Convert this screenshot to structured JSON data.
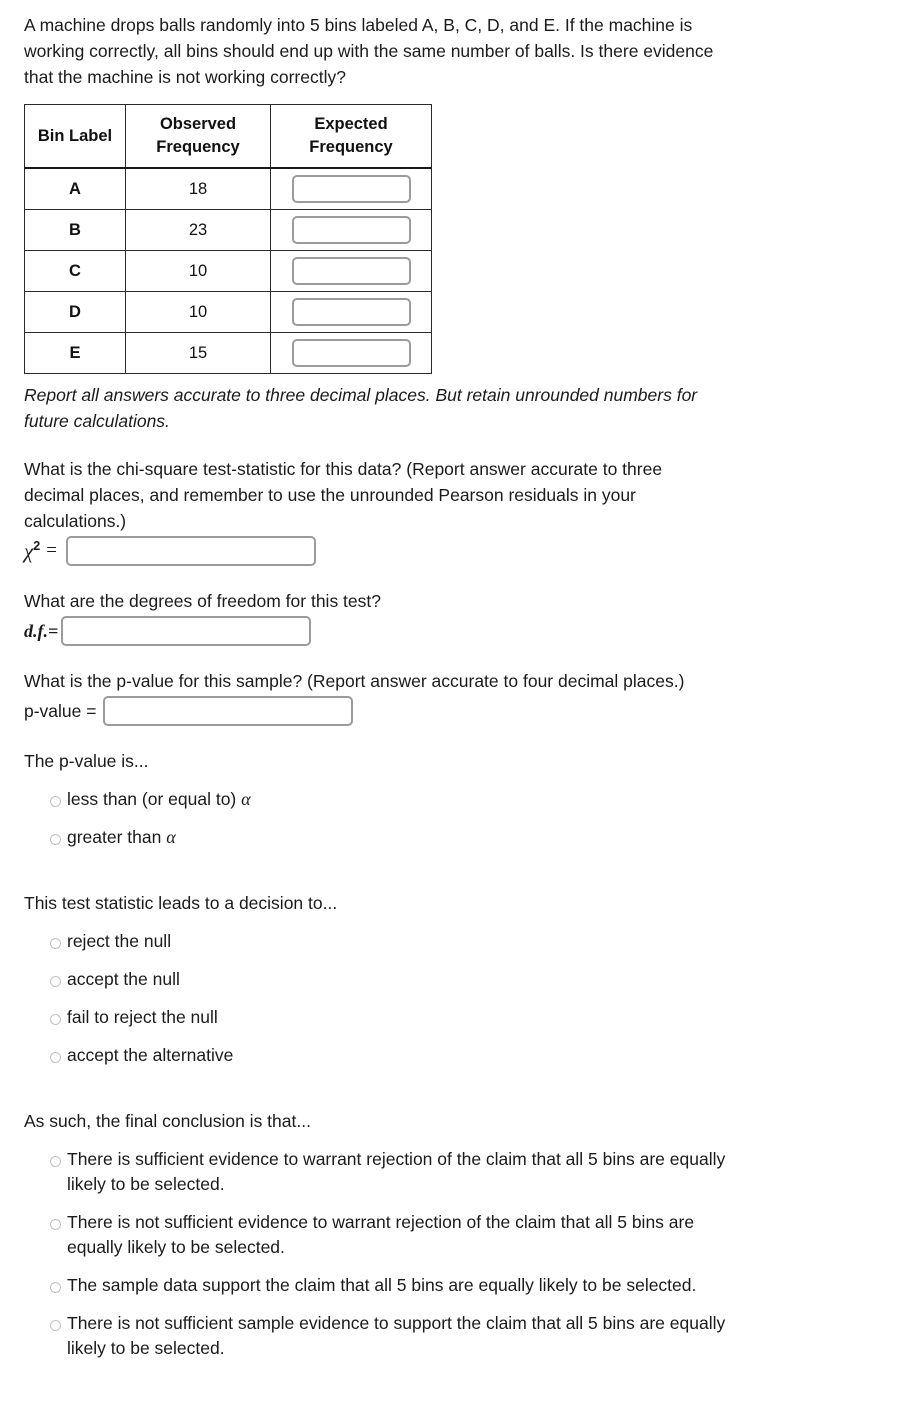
{
  "prompt": {
    "intro": "A machine drops balls randomly into 5 bins labeled A, B, C, D, and E. If the machine is working correctly, all bins should end up with the same number of balls. Is there evidence that the machine is not working correctly?",
    "rounding_note": "Report all answers accurate to three decimal places. But retain unrounded numbers for future calculations."
  },
  "table": {
    "headers": {
      "bin": "Bin Label",
      "observed": "Observed Frequency",
      "expected": "Expected Frequency"
    },
    "rows": [
      {
        "bin": "A",
        "observed": "18",
        "expected": ""
      },
      {
        "bin": "B",
        "observed": "23",
        "expected": ""
      },
      {
        "bin": "C",
        "observed": "10",
        "expected": ""
      },
      {
        "bin": "D",
        "observed": "10",
        "expected": ""
      },
      {
        "bin": "E",
        "observed": "15",
        "expected": ""
      }
    ]
  },
  "chi_square": {
    "question": "What is the chi-square test-statistic for this data? (Report answer accurate to three decimal places, and remember to use the unrounded Pearson residuals in your calculations.)",
    "symbol": "χ",
    "exponent": "2",
    "equals": "=",
    "value": ""
  },
  "degrees_of_freedom": {
    "question": "What are the degrees of freedom for this test?",
    "label": "d.f.=",
    "value": ""
  },
  "p_value": {
    "question": "What is the p-value for this sample? (Report answer accurate to four decimal places.)",
    "label": "p-value =",
    "value": ""
  },
  "p_value_comparison": {
    "question": "The p-value is...",
    "options": [
      "less than (or equal to) α",
      "greater than α"
    ]
  },
  "decision": {
    "question": "This test statistic leads to a decision to...",
    "options": [
      "reject the null",
      "accept the null",
      "fail to reject the null",
      "accept the alternative"
    ]
  },
  "conclusion": {
    "question": "As such, the final conclusion is that...",
    "options": [
      "There is sufficient evidence to warrant rejection of the claim that all 5 bins are equally likely to be selected.",
      "There is not sufficient evidence to warrant rejection of the claim that all 5 bins are equally likely to be selected.",
      "The sample data support the claim that all 5 bins are equally likely to be selected.",
      "There is not sufficient sample evidence to support the claim that all 5 bins are equally likely to be selected."
    ]
  },
  "colors": {
    "text": "#1b1b1b",
    "table_border": "#2b2b2b",
    "input_border": "#9b9b9b",
    "radio_border": "#c2c2c2"
  }
}
